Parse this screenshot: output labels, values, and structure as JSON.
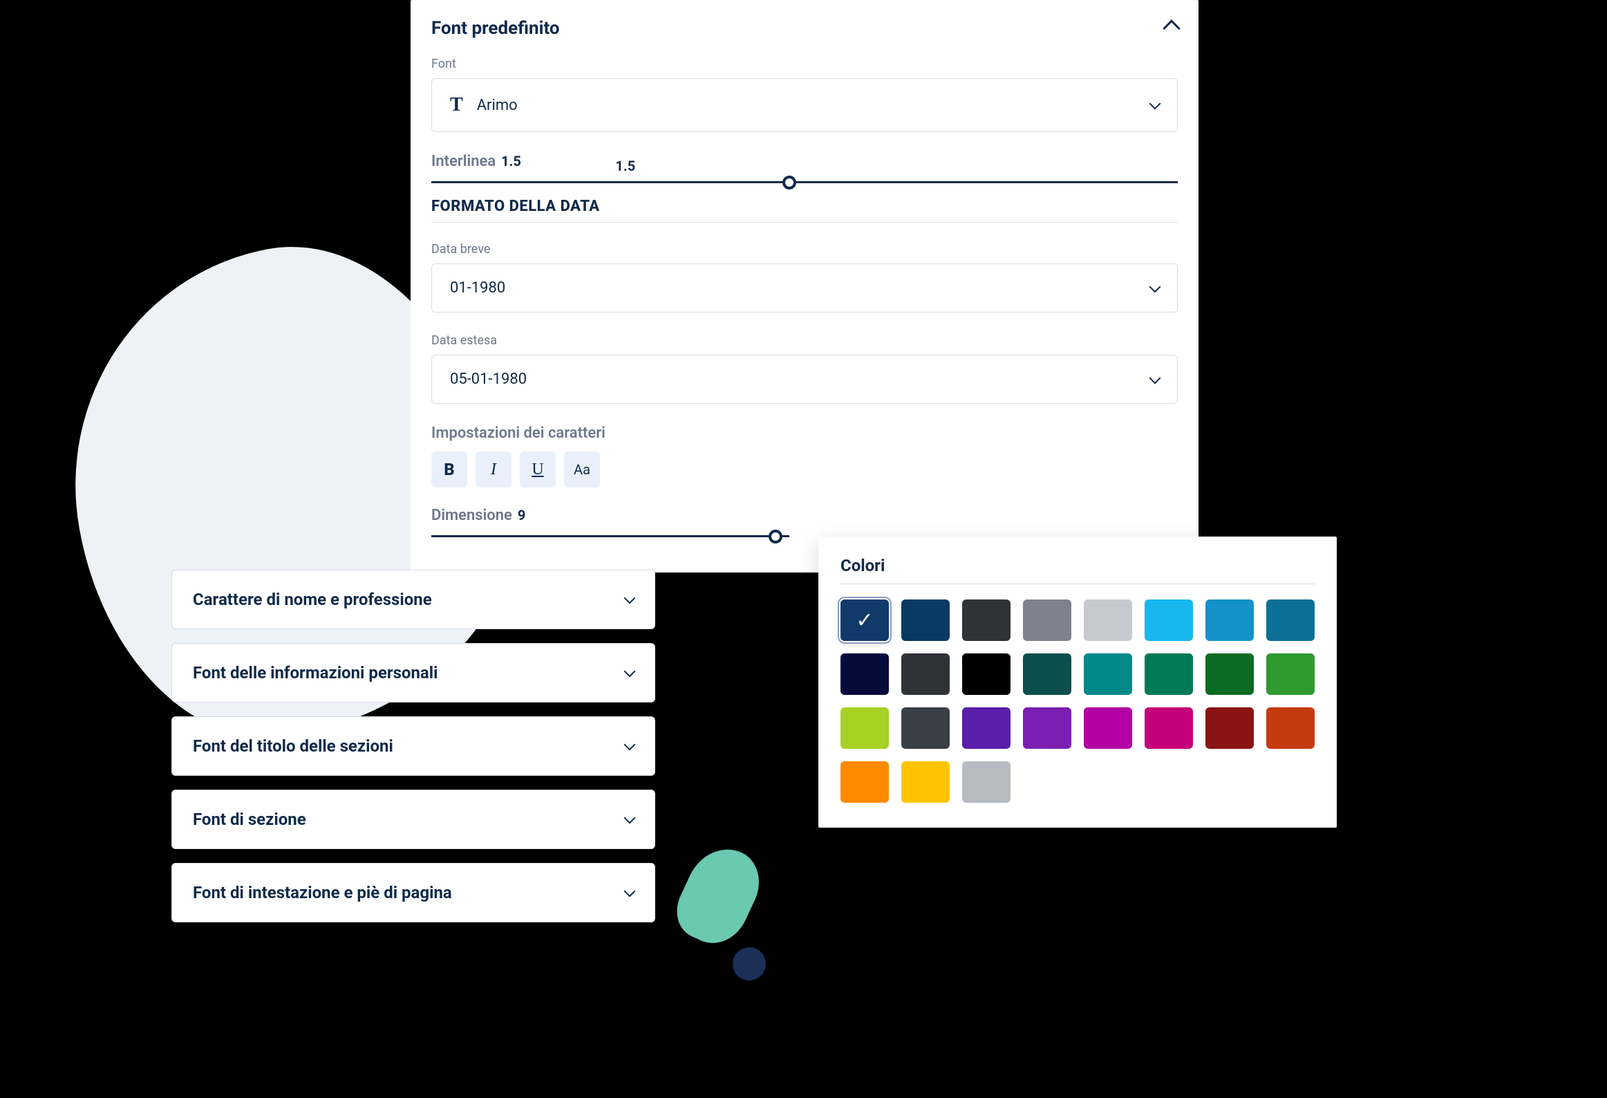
{
  "panel": {
    "title": "Font predefinito",
    "fontLabel": "Font",
    "fontValue": "Arimo",
    "interlineaLabel": "Interlinea",
    "interlineaValue": "1.5",
    "interlineaTick": "1.5",
    "interlineaPercent": 48,
    "dateFormatTitle": "FORMATO DELLA DATA",
    "shortDateLabel": "Data breve",
    "shortDateValue": "01-1980",
    "longDateLabel": "Data estesa",
    "longDateValue": "05-01-1980",
    "charSettingsLabel": "Impostazioni dei caratteri",
    "sizeLabel": "Dimensione",
    "sizeValue": "9",
    "sizePercent": 45
  },
  "formatButtons": {
    "bold": "B",
    "italic": "I",
    "underline": "U",
    "case": "Aa"
  },
  "accordions": [
    "Carattere di nome e professione",
    "Font delle informazioni personali",
    "Font del titolo delle sezioni",
    "Font di sezione",
    "Font di intestazione e piè di pagina"
  ],
  "colors": {
    "title": "Colori",
    "selectedIndex": 0,
    "swatches": [
      "#0f3a6a",
      "#083a63",
      "#2f3237",
      "#7d838c",
      "#c6cad0",
      "#18b6ef",
      "#1492c9",
      "#0c6f98",
      "#060a3a",
      "#2f3237",
      "#000000",
      "#0a4f4b",
      "#00888a",
      "#007a55",
      "#0b6b23",
      "#2f9a2f",
      "#a5d225",
      "#3a3f47",
      "#5a1eaa",
      "#7a1fb2",
      "#b300a4",
      "#c4007a",
      "#8a1414",
      "#c63a0f",
      "#ff8a00",
      "#ffc400",
      "#b6bbc2"
    ]
  }
}
